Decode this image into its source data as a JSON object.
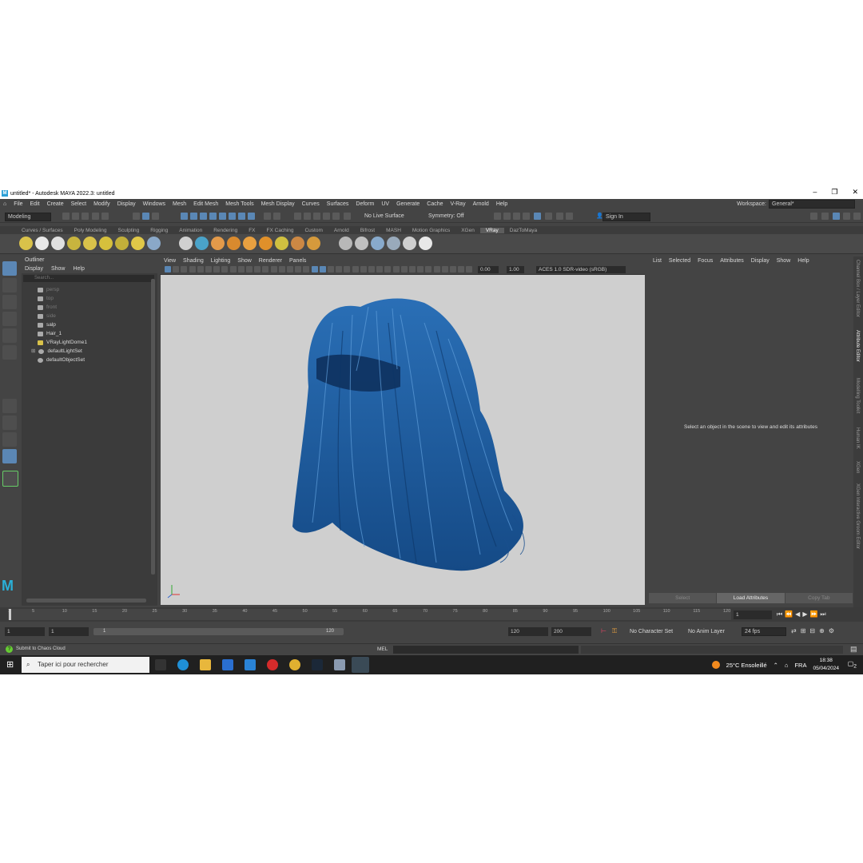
{
  "window": {
    "title": "untitled* - Autodesk MAYA 2022.3: untitled"
  },
  "menubar": {
    "items": [
      "File",
      "Edit",
      "Create",
      "Select",
      "Modify",
      "Display",
      "Windows",
      "Mesh",
      "Edit Mesh",
      "Mesh Tools",
      "Mesh Display",
      "Curves",
      "Surfaces",
      "Deform",
      "UV",
      "Generate",
      "Cache",
      "V-Ray",
      "Arnold",
      "Help"
    ],
    "workspace_label": "Workspace:",
    "workspace_value": "General*"
  },
  "statusline": {
    "mode": "Modeling",
    "live_surface": "No Live Surface",
    "symmetry": "Symmetry: Off",
    "sign_in": "Sign In"
  },
  "shelf": {
    "tabs": [
      "Curves / Surfaces",
      "Poly Modeling",
      "Sculpting",
      "Rigging",
      "Animation",
      "Rendering",
      "FX",
      "FX Caching",
      "Custom",
      "Arnold",
      "Bifrost",
      "MASH",
      "Motion Graphics",
      "XGen",
      "VRay",
      "DazToMaya"
    ],
    "active_tab": "VRay",
    "icon_colors": [
      "#d9c24a",
      "#e8e8e8",
      "#e0e0e0",
      "#c8b43e",
      "#d9c24a",
      "#d6c03c",
      "#c2b03a",
      "#e0c848",
      "#8aa8c8",
      "#d0d0d0",
      "#4aa3c9",
      "#e39a4a",
      "#d98a2e",
      "#e8a040",
      "#e0902a",
      "#d0c040",
      "#cc8844",
      "#d59a3c",
      "#b8b8b8",
      "#c0c0c0",
      "#8ac",
      "#9ab",
      "#cfcfcf",
      "#e8e8e8"
    ]
  },
  "outliner": {
    "title": "Outliner",
    "menu": [
      "Display",
      "Show",
      "Help"
    ],
    "search_placeholder": "Search...",
    "items": [
      {
        "label": "persp",
        "dim": true
      },
      {
        "label": "top",
        "dim": true
      },
      {
        "label": "front",
        "dim": true
      },
      {
        "label": "side",
        "dim": true
      },
      {
        "label": "salp",
        "dim": false
      },
      {
        "label": "Hair_1",
        "dim": false
      },
      {
        "label": "VRayLightDome1",
        "dim": false
      },
      {
        "label": "defaultLightSet",
        "dim": false
      },
      {
        "label": "defaultObjectSet",
        "dim": false
      }
    ]
  },
  "viewport": {
    "menu": [
      "View",
      "Shading",
      "Lighting",
      "Show",
      "Renderer",
      "Panels"
    ],
    "exposure": "0.00",
    "gamma": "1.00",
    "color_space": "ACES 1.0 SDR-video (sRGB)",
    "hair_color": "#1f5e9e"
  },
  "attribute_editor": {
    "menu": [
      "List",
      "Selected",
      "Focus",
      "Attributes",
      "Display",
      "Show",
      "Help"
    ],
    "message": "Select an object in the scene to view and edit its attributes",
    "buttons": [
      "Select",
      "Load Attributes",
      "Copy Tab"
    ]
  },
  "side_tabs": [
    "Channel Box / Layer Editor",
    "Attribute Editor",
    "Modelling Toolkit",
    "Human IK",
    "XGen",
    "XGen Interactive Groom Editor"
  ],
  "timeline": {
    "ticks": [
      "1",
      "5",
      "10",
      "15",
      "20",
      "25",
      "30",
      "35",
      "40",
      "45",
      "50",
      "55",
      "60",
      "65",
      "70",
      "75",
      "80",
      "85",
      "90",
      "95",
      "100",
      "105",
      "110",
      "115",
      "120"
    ],
    "current_frame": "1"
  },
  "range": {
    "start": "1",
    "playback_start": "1",
    "slider_left": "1",
    "slider_right": "120",
    "playback_end": "120",
    "end": "200",
    "character_set": "No Character Set",
    "anim_layer": "No Anim Layer",
    "fps": "24 fps"
  },
  "commandline": {
    "help": "Submit to Chaos Cloud",
    "lang": "MEL"
  },
  "taskbar": {
    "search_placeholder": "Taper ici pour rechercher",
    "weather": "25°C  Ensoleillé",
    "lang": "FRA",
    "time": "18:38",
    "date": "05/04/2024",
    "notifications": "2"
  }
}
